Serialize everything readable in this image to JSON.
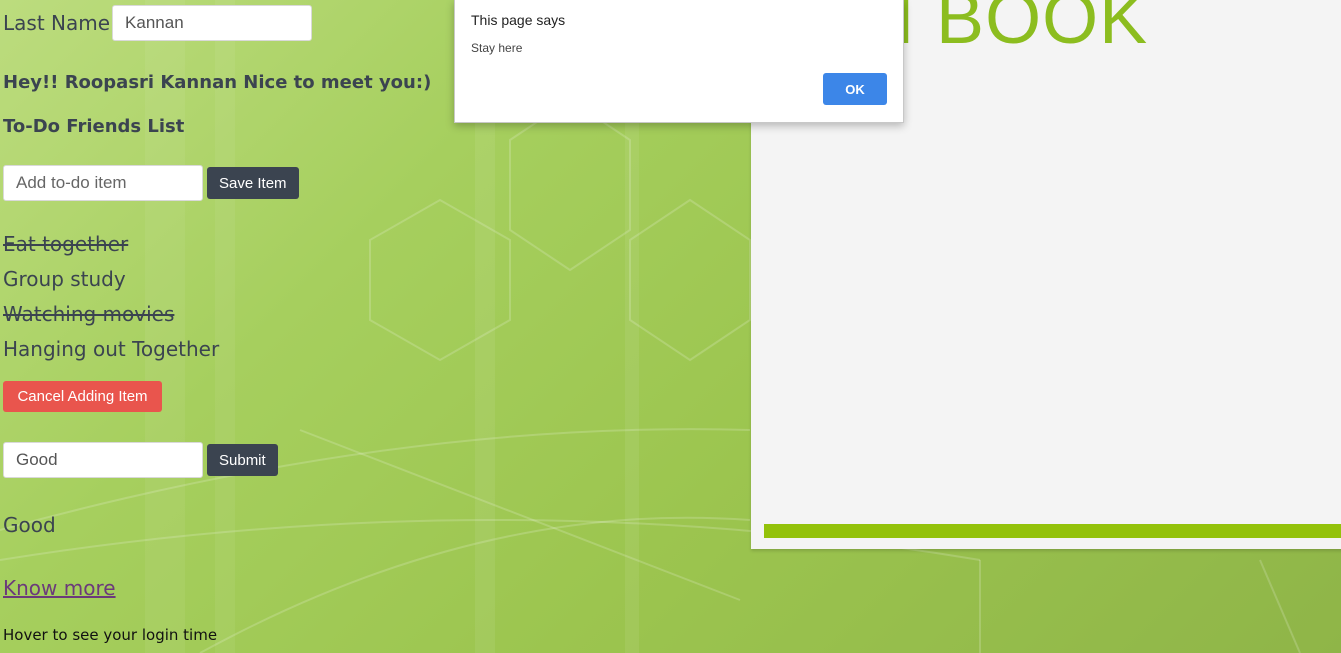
{
  "form": {
    "last_name_label": "Last Name",
    "last_name_value": "Kannan"
  },
  "greeting": "Hey!! Roopasri Kannan Nice to meet you:)",
  "todo": {
    "heading": "To-Do Friends List",
    "input_placeholder": "Add to-do item",
    "save_label": "Save Item",
    "items": [
      {
        "label": "Eat together",
        "done": true
      },
      {
        "label": "Group study",
        "done": false
      },
      {
        "label": "Watching movies",
        "done": true
      },
      {
        "label": "Hanging out Together",
        "done": false
      }
    ],
    "cancel_label": "Cancel Adding Item"
  },
  "feedback": {
    "input_value": "Good",
    "submit_label": "Submit",
    "result": "Good"
  },
  "links": {
    "know_more": "Know more"
  },
  "hint": "Hover to see your login time",
  "panel": {
    "title": "LAM BOOK"
  },
  "dialog": {
    "title": "This page says",
    "message": "Stay here",
    "ok_label": "OK"
  },
  "colors": {
    "dark_button": "#3b4450",
    "red_button": "#e9554d",
    "ok_button": "#3c86e8",
    "brand_green": "#8cbd1f"
  }
}
